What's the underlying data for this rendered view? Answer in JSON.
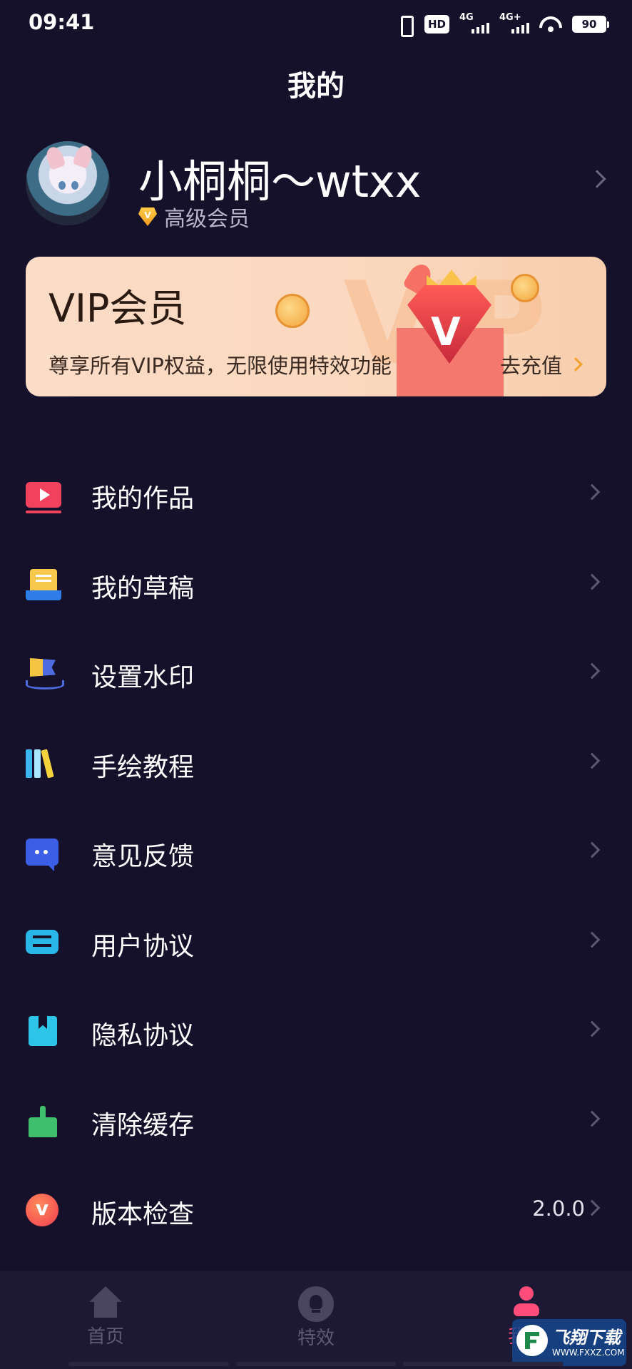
{
  "status_bar": {
    "time": "09:41",
    "hd_label": "HD",
    "sim1_label": "4G",
    "sim2_label": "4G+",
    "battery": "90"
  },
  "header": {
    "title": "我的"
  },
  "profile": {
    "username": "小桐桐～wtxx",
    "member_level": "高级会员",
    "badge_letter": "V"
  },
  "vip_card": {
    "title": "VIP会员",
    "description": "尊享所有VIP权益，无限使用特效功能",
    "action": "去充值",
    "deco_text": "VIP",
    "gem_letter": "V"
  },
  "menu": {
    "items": [
      {
        "label": "我的作品",
        "icon": "video-icon"
      },
      {
        "label": "我的草稿",
        "icon": "draft-icon"
      },
      {
        "label": "设置水印",
        "icon": "watermark-flag-icon"
      },
      {
        "label": "手绘教程",
        "icon": "books-icon"
      },
      {
        "label": "意见反馈",
        "icon": "chat-bubble-icon"
      },
      {
        "label": "用户协议",
        "icon": "agreement-icon"
      },
      {
        "label": "隐私协议",
        "icon": "bookmark-icon"
      },
      {
        "label": "清除缓存",
        "icon": "broom-icon"
      },
      {
        "label": "版本检查",
        "icon": "version-icon",
        "value": "2.0.0"
      }
    ]
  },
  "tab_bar": {
    "tabs": [
      {
        "label": "首页",
        "icon": "home-icon"
      },
      {
        "label": "特效",
        "icon": "bulb-icon"
      },
      {
        "label": "我的",
        "icon": "person-icon",
        "active": true
      }
    ]
  },
  "watermark": {
    "title": "飞翔下载",
    "url": "WWW.FXXZ.COM"
  },
  "colors": {
    "background": "#15112a",
    "tab_bar": "#1d1934",
    "accent": "#ff4c7a",
    "vip_card": "#fbdcc7",
    "vip_gold": "#f0a22e"
  }
}
